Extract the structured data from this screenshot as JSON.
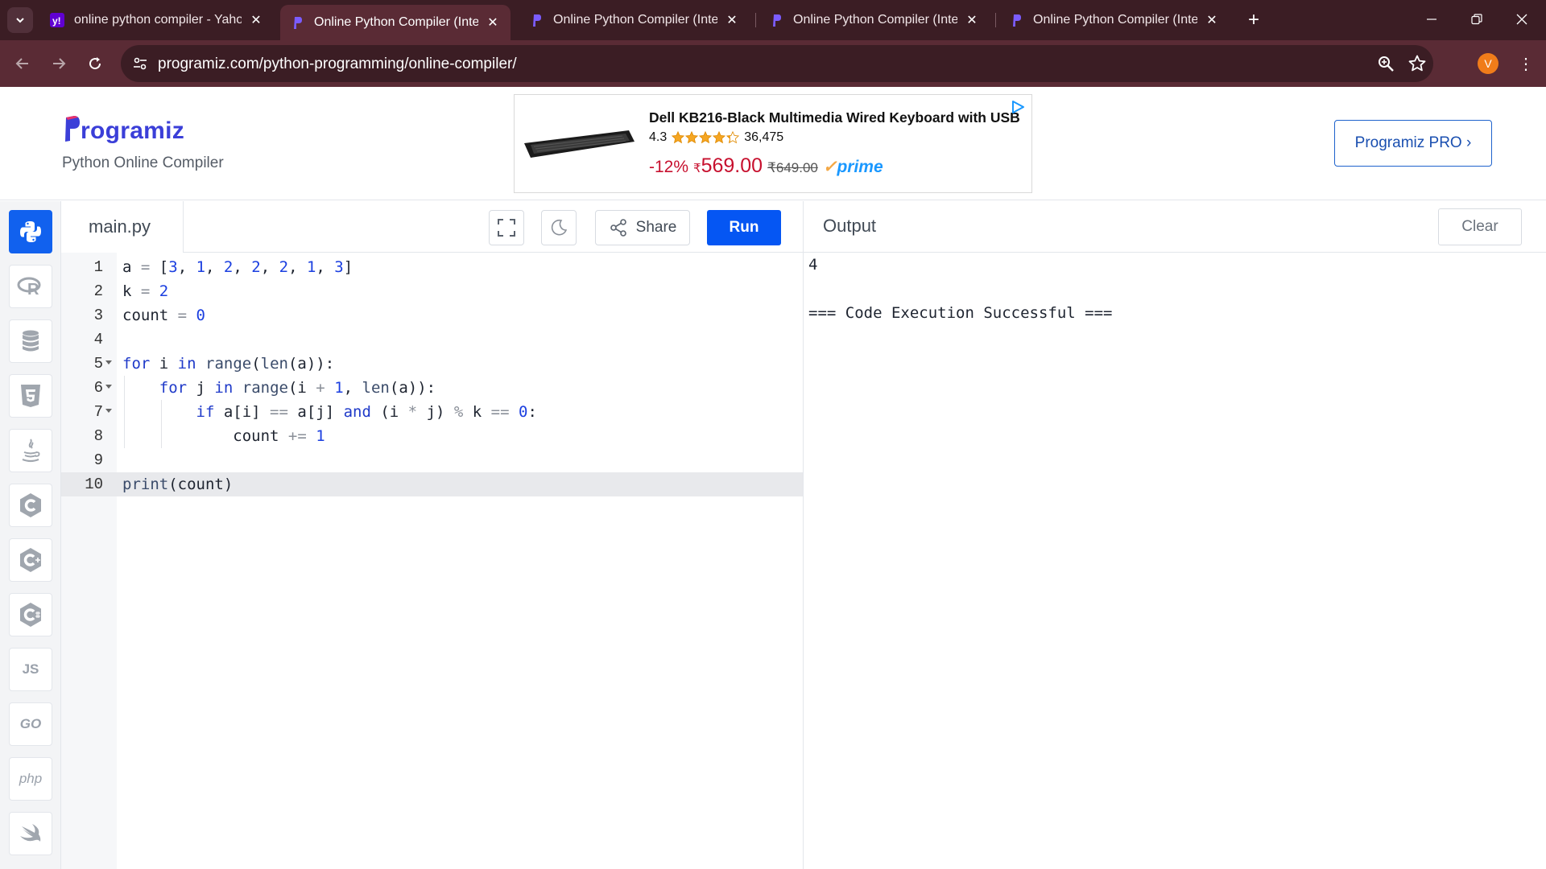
{
  "browser": {
    "tabs": [
      {
        "title": "online python compiler - Yahoo",
        "favicon": "yahoo-icon",
        "active": false
      },
      {
        "title": "Online Python Compiler (Interpreter)",
        "favicon": "programiz-icon",
        "active": true
      },
      {
        "title": "Online Python Compiler (Interpreter)",
        "favicon": "programiz-icon",
        "active": false
      },
      {
        "title": "Online Python Compiler (Interpreter)",
        "favicon": "programiz-icon",
        "active": false
      },
      {
        "title": "Online Python Compiler (Interpreter)",
        "favicon": "programiz-icon",
        "active": false
      }
    ],
    "url": "programiz.com/python-programming/online-compiler/",
    "profile_initial": "V"
  },
  "header": {
    "logo_text": "rogramiz",
    "subtitle": "Python Online Compiler",
    "pro_button": "Programiz PRO ›"
  },
  "ad": {
    "title": "Dell KB216-Black Multimedia Wired Keyboard with USB",
    "rating": "4.3",
    "stars": 4.3,
    "review_count": "36,475",
    "discount": "-12%",
    "currency": "₹",
    "price": "569.00",
    "old_price": "₹649.00",
    "prime": "prime"
  },
  "languages": [
    "python-icon",
    "r-icon",
    "sql-icon",
    "html5-icon",
    "java-icon",
    "c-icon",
    "cpp-icon",
    "csharp-icon",
    "JS",
    "GO",
    "php",
    "swift-icon"
  ],
  "editor": {
    "file_name": "main.py",
    "share_label": "Share",
    "run_label": "Run",
    "current_line": 10,
    "lines": [
      "a = [3, 1, 2, 2, 2, 1, 3]",
      "k = 2",
      "count = 0",
      "",
      "for i in range(len(a)):",
      "    for j in range(i + 1, len(a)):",
      "        if a[i] == a[j] and (i * j) % k == 0:",
      "            count += 1",
      "",
      "print(count)"
    ]
  },
  "output": {
    "title": "Output",
    "clear_label": "Clear",
    "lines": [
      "4",
      "",
      "=== Code Execution Successful ==="
    ]
  }
}
